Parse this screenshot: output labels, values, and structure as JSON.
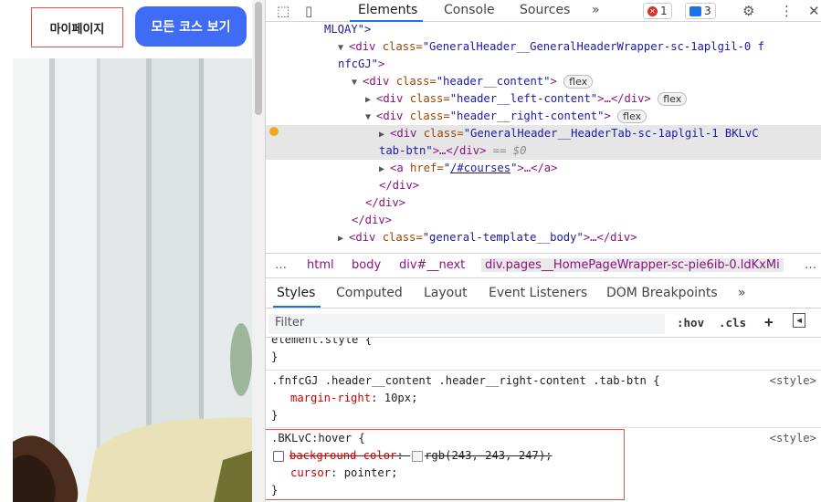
{
  "page": {
    "mypage_label": "마이페이지",
    "courses_label": "모든 코스 보기"
  },
  "devtools": {
    "tabs": [
      "Elements",
      "Console",
      "Sources",
      "»"
    ],
    "errors_count": "1",
    "messages_count": "3",
    "dom_lines": {
      "l0_val": "MLQAY\">",
      "l1_tag": "<div ",
      "l1_attr": "class=",
      "l1_val": "\"GeneralHeader__GeneralHeaderWrapper-sc-1aplgil-0 f",
      "l2_val": "nfcGJ\"",
      "l2_tag": ">",
      "l3_tag": "<div ",
      "l3_attr": "class=",
      "l3_val": "\"header__content\"",
      "l3_end": ">",
      "l3_pill": "flex",
      "l4_tag": "<div ",
      "l4_attr": "class=",
      "l4_val": "\"header__left-content\"",
      "l4_end": ">…</div>",
      "l4_pill": "flex",
      "l5_tag": "<div ",
      "l5_attr": "class=",
      "l5_val": "\"header__right-content\"",
      "l5_end": ">",
      "l5_pill": "flex",
      "l6_tag": "<div ",
      "l6_attr": "class=",
      "l6_val": "\"GeneralHeader__HeaderTab-sc-1aplgil-1 BKLvC",
      "l7_val": "tab-btn\"",
      "l7_end": ">…</div>",
      "l7_eq": "== $0",
      "l8_tag": "<a ",
      "l8_attr": "href=",
      "l8_q1": "\"",
      "l8_link": "/#courses",
      "l8_q2": "\"",
      "l8_end": ">…</a>",
      "l9": "</div>",
      "l10": "</div>",
      "l11": "</div>",
      "l12_tag": "<div ",
      "l12_attr": "class=",
      "l12_val": "\"general-template__body\"",
      "l12_end": ">…</div>"
    },
    "breadcrumbs": [
      "…",
      "html",
      "body",
      "div#__next",
      "div.pages__HomePageWrapper-sc-pie6ib-0.ldKxMi",
      "…"
    ],
    "subtabs": [
      "Styles",
      "Computed",
      "Layout",
      "Event Listeners",
      "DOM Breakpoints",
      "»"
    ],
    "filter_placeholder": "Filter",
    "filter_hov": ":hov",
    "filter_cls": ".cls",
    "rules": {
      "element_style": "element.style {",
      "close": "}",
      "r1_selector": ".fnfcGJ .header__content .header__right-content .tab-btn {",
      "r1_src": "<style>",
      "r1_prop": "margin-right",
      "r1_value": ": 10px;",
      "r2_selector": ".BKLvC:hover {",
      "r2_src": "<style>",
      "r2_prop1": "background-color",
      "r2_value1_a": ": ",
      "r2_value1_b": "rgb(243, 243, 247);",
      "r2_prop2": "cursor",
      "r2_value2": ": pointer;"
    }
  }
}
